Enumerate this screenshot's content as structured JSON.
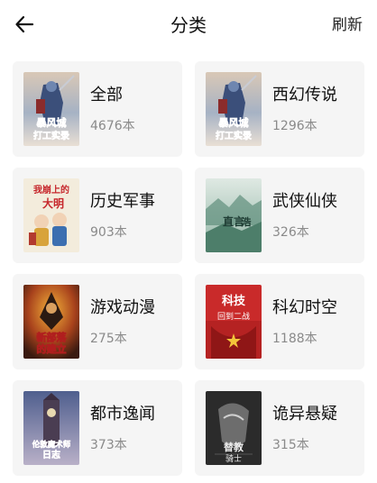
{
  "header": {
    "title": "分类",
    "refresh_label": "刷新",
    "back_icon": "arrow-left-icon"
  },
  "categories": [
    {
      "name": "全部",
      "count": "4676本",
      "cover_title_lines": [
        "暴风城",
        "打工实录"
      ]
    },
    {
      "name": "西幻传说",
      "count": "1296本",
      "cover_title_lines": [
        "暴风城",
        "打工实录"
      ]
    },
    {
      "name": "历史军事",
      "count": "903本",
      "cover_title_lines": [
        "我崩上的",
        "大明"
      ]
    },
    {
      "name": "武侠仙侠",
      "count": "326本",
      "cover_title_lines": [
        "直言",
        "浩"
      ]
    },
    {
      "name": "游戏动漫",
      "count": "275本",
      "cover_title_lines": [
        "新部落",
        "的建立"
      ]
    },
    {
      "name": "科幻时空",
      "count": "1188本",
      "cover_title_lines": [
        "科技",
        "回到二战"
      ]
    },
    {
      "name": "都市逸闻",
      "count": "373本",
      "cover_title_lines": [
        "伦敦魔术师",
        "日志"
      ]
    },
    {
      "name": "诡异悬疑",
      "count": "315本",
      "cover_title_lines": [
        "替教",
        "骑士"
      ]
    }
  ],
  "colors": {
    "card_background": "#f5f5f5",
    "count_text": "#8a8a8a",
    "title_text": "#111111"
  }
}
